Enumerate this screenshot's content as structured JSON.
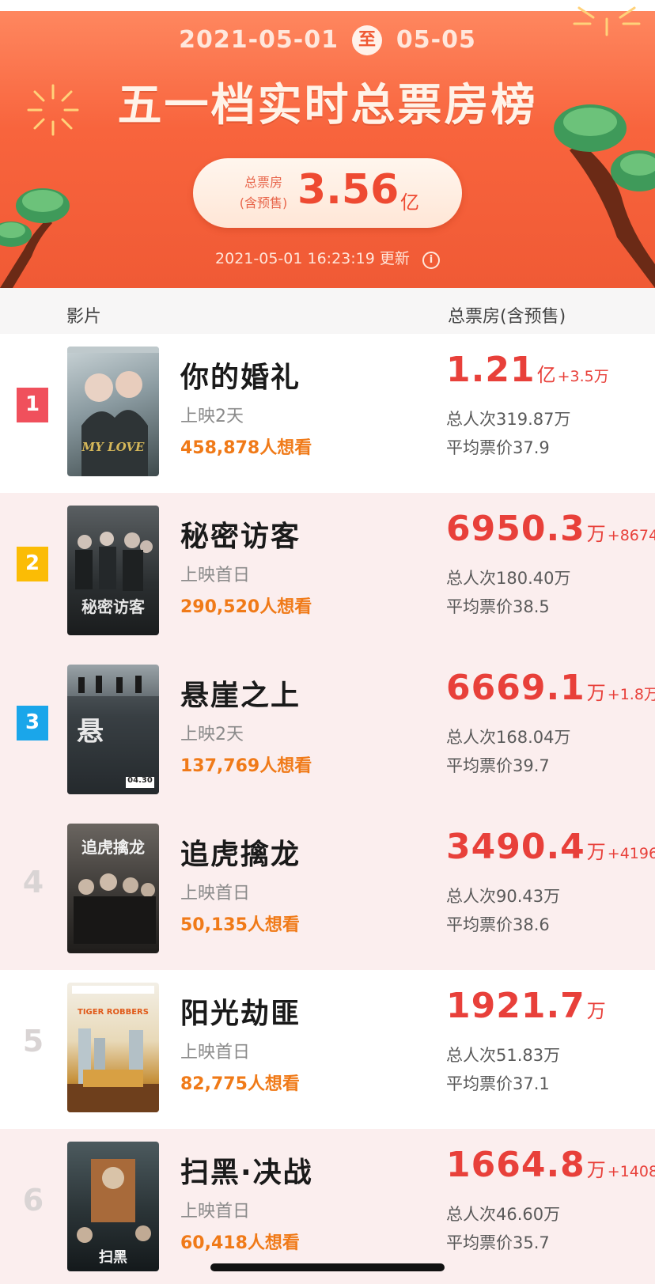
{
  "header": {
    "date_start": "2021-05-01",
    "date_connector": "至",
    "date_end": "05-05",
    "title": "五一档实时总票房榜",
    "total_label_line1": "总票房",
    "total_label_line2": "(含预售)",
    "total_value": "3.56",
    "total_unit": "亿",
    "update_time": "2021-05-01 16:23:19 更新",
    "info_icon": "info-icon"
  },
  "columns": {
    "film": "影片",
    "box_office": "总票房(含预售)"
  },
  "movies": [
    {
      "rank": "1",
      "title": "你的婚礼",
      "release": "上映2天",
      "want": "458,878人想看",
      "box_value": "1.21",
      "box_unit": "亿",
      "box_delta": "+3.5万",
      "attendance": "总人次319.87万",
      "avg_price": "平均票价37.9",
      "poster_text": "MY LOVE"
    },
    {
      "rank": "2",
      "title": "秘密访客",
      "release": "上映首日",
      "want": "290,520人想看",
      "box_value": "6950.3",
      "box_unit": "万",
      "box_delta": "+8674",
      "attendance": "总人次180.40万",
      "avg_price": "平均票价38.5",
      "poster_text": "秘密访客"
    },
    {
      "rank": "3",
      "title": "悬崖之上",
      "release": "上映2天",
      "want": "137,769人想看",
      "box_value": "6669.1",
      "box_unit": "万",
      "box_delta": "+1.8万",
      "attendance": "总人次168.04万",
      "avg_price": "平均票价39.7",
      "poster_text": "04.30"
    },
    {
      "rank": "4",
      "title": "追虎擒龙",
      "release": "上映首日",
      "want": "50,135人想看",
      "box_value": "3490.4",
      "box_unit": "万",
      "box_delta": "+4196",
      "attendance": "总人次90.43万",
      "avg_price": "平均票价38.6",
      "poster_text": "追虎擒龙"
    },
    {
      "rank": "5",
      "title": "阳光劫匪",
      "release": "上映首日",
      "want": "82,775人想看",
      "box_value": "1921.7",
      "box_unit": "万",
      "box_delta": "",
      "attendance": "总人次51.83万",
      "avg_price": "平均票价37.1",
      "poster_text": "TIGER ROBBERS"
    },
    {
      "rank": "6",
      "title": "扫黑·决战",
      "release": "上映首日",
      "want": "60,418人想看",
      "box_value": "1664.8",
      "box_unit": "万",
      "box_delta": "+1408",
      "attendance": "总人次46.60万",
      "avg_price": "平均票价35.7",
      "poster_text": "扫黑"
    }
  ],
  "colors": {
    "header_orange": "#f8643d",
    "box_red": "#e8403a",
    "want_orange": "#f07a18",
    "rank1": "#f0505c",
    "rank2": "#fbbc05",
    "rank3": "#1aa6ea"
  }
}
